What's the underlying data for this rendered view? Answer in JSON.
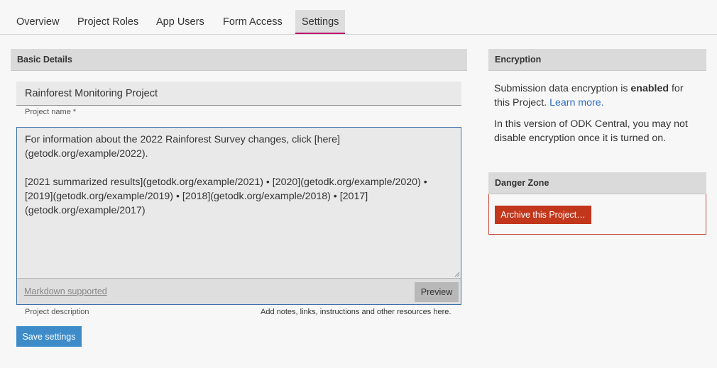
{
  "tabs": [
    {
      "label": "Overview"
    },
    {
      "label": "Project Roles"
    },
    {
      "label": "App Users"
    },
    {
      "label": "Form Access"
    },
    {
      "label": "Settings",
      "active": true
    }
  ],
  "basic_details": {
    "heading": "Basic Details",
    "project_name_value": "Rainforest Monitoring Project",
    "project_name_label": "Project name *",
    "description_value": "For information about the 2022 Rainforest Survey changes, click [here]\n(getodk.org/example/2022).\n\n[2021 summarized results](getodk.org/example/2021) • [2020](getodk.org/example/2020) •\n[2019](getodk.org/example/2019) • [2018](getodk.org/example/2018) • [2017]\n(getodk.org/example/2017)",
    "markdown_link": "Markdown supported",
    "preview_label": "Preview",
    "description_label": "Project description",
    "description_hint": "Add notes, links, instructions and other resources here.",
    "save_label": "Save settings"
  },
  "encryption": {
    "heading": "Encryption",
    "line1_prefix": "Submission data encryption is ",
    "line1_bold": "enabled",
    "line1_suffix": " for this Project. ",
    "learn_more": "Learn more.",
    "line2": "In this version of ODK Central, you may not disable encryption once it is turned on."
  },
  "danger_zone": {
    "heading": "Danger Zone",
    "archive_label": "Archive this Project…"
  },
  "colors": {
    "tab_active_underline": "#bd006b",
    "save_button": "#3d8cc9",
    "archive_button": "#c2361b",
    "link": "#2b6cc4",
    "focus_border": "#3f6fa7"
  }
}
